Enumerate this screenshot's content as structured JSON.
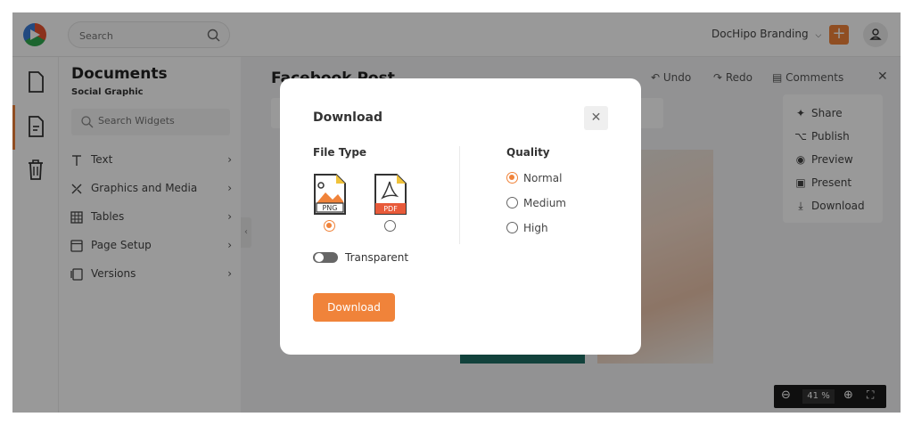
{
  "topbar": {
    "search_placeholder": "Search",
    "brand_label": "DocHipo Branding",
    "plus_label": "+"
  },
  "sidebar": {
    "title": "Documents",
    "subtitle": "Social Graphic",
    "widget_search_placeholder": "Search Widgets",
    "items": [
      {
        "label": "Text",
        "icon": "text-icon"
      },
      {
        "label": "Graphics and Media",
        "icon": "graphics-icon"
      },
      {
        "label": "Tables",
        "icon": "table-icon"
      },
      {
        "label": "Page Setup",
        "icon": "page-setup-icon"
      },
      {
        "label": "Versions",
        "icon": "versions-icon"
      }
    ]
  },
  "editor": {
    "doc_title": "Facebook Post",
    "undo_label": "Undo",
    "redo_label": "Redo",
    "comments_label": "Comments"
  },
  "share_menu": {
    "items": [
      {
        "label": "Share"
      },
      {
        "label": "Publish"
      },
      {
        "label": "Preview"
      },
      {
        "label": "Present"
      },
      {
        "label": "Download"
      }
    ]
  },
  "zoom": {
    "value": "41",
    "unit": "%"
  },
  "modal": {
    "title": "Download",
    "file_type_label": "File Type",
    "quality_label": "Quality",
    "file_types": [
      {
        "label": "PNG",
        "selected": true,
        "color": "#f0833a"
      },
      {
        "label": "PDF",
        "selected": false,
        "color": "#f0833a"
      }
    ],
    "quality_options": [
      {
        "label": "Normal",
        "selected": true
      },
      {
        "label": "Medium",
        "selected": false
      },
      {
        "label": "High",
        "selected": false
      }
    ],
    "transparent_label": "Transparent",
    "download_button": "Download"
  },
  "colors": {
    "accent": "#f0833a",
    "overlay": "rgba(0,0,0,0.40)"
  }
}
